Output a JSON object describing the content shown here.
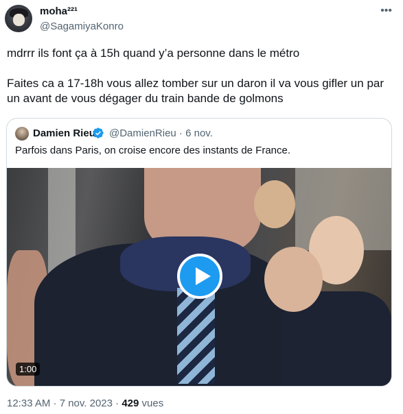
{
  "author": {
    "display_name": "moha²²¹",
    "handle": "@SagamiyaKonro"
  },
  "more_icon": "more-horizontal-icon",
  "tweet": {
    "text": "mdrrr ils font ça à 15h quand y’a personne dans le métro\n\nFaites ca a 17-18h vous allez tomber sur un daron il va vous gifler un par un avant de vous dégager du train bande de golmons"
  },
  "quoted": {
    "display_name": "Damien Rieu",
    "verified": true,
    "handle_date": "@DamienRieu · 6 nov.",
    "text": "Parfois dans Paris, on croise encore des instants de France.",
    "video": {
      "duration": "1:00",
      "play_icon": "play-icon"
    }
  },
  "meta": {
    "time_date": "12:33 AM · 7 nov. 2023 · ",
    "views_count": "429",
    "views_label": " vues"
  },
  "colors": {
    "accent": "#1d9bf0",
    "secondary_text": "#536471",
    "border": "#cfd9de"
  }
}
